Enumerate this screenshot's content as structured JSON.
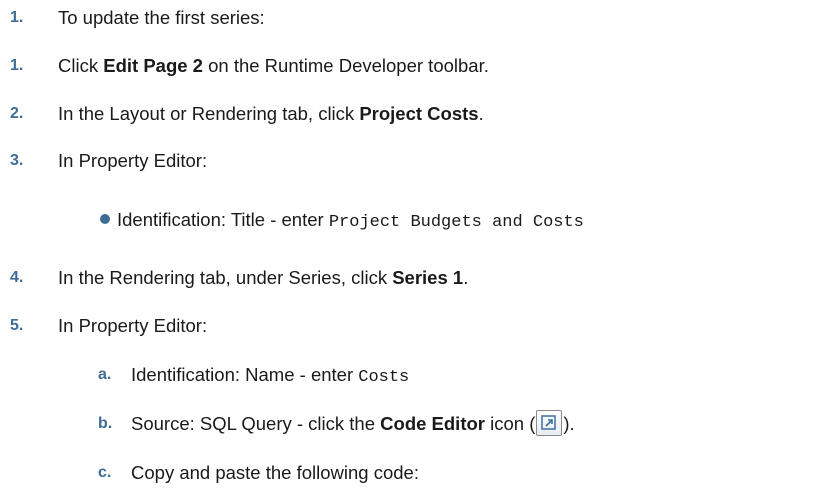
{
  "steps": [
    {
      "num": "1.",
      "text": "To update the first series:"
    },
    {
      "num": "1.",
      "pre": "Click ",
      "bold": "Edit Page 2",
      "post": " on the Runtime Developer toolbar."
    },
    {
      "num": "2.",
      "pre": "In the Layout or Rendering tab, click ",
      "bold": "Project Costs",
      "post": "."
    },
    {
      "num": "3.",
      "text": "In Property Editor:"
    },
    {
      "bullet_label": "Identification: Title - enter ",
      "bullet_code": "Project Budgets and Costs"
    },
    {
      "num": "4.",
      "pre": "In the Rendering tab, under Series, click ",
      "bold": "Series 1",
      "post": "."
    },
    {
      "num": "5.",
      "text": "In Property Editor:"
    },
    {
      "letter": "a.",
      "pre": "Identification: Name - enter ",
      "code": "Costs"
    },
    {
      "letter": "b.",
      "pre": "Source: SQL Query - click the ",
      "bold": "Code Editor",
      "mid": " icon (",
      "post": ")."
    },
    {
      "letter": "c.",
      "text": "Copy and paste the following code:"
    }
  ],
  "icons": {
    "code_editor": "code-editor-icon"
  },
  "colors": {
    "accent": "#3f6c96",
    "text": "#1a1a1a"
  }
}
